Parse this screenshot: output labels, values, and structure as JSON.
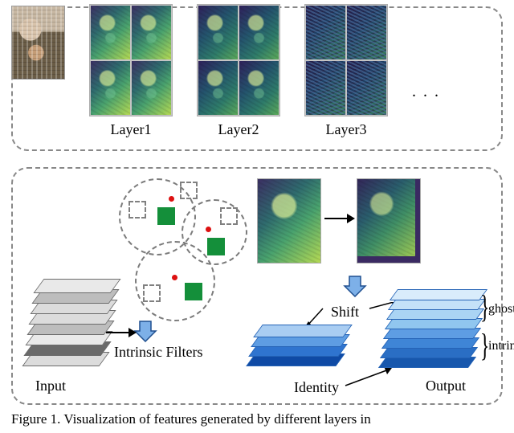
{
  "top": {
    "layers_shown": 3,
    "layer_labels": [
      "Layer1",
      "Layer2",
      "Layer3"
    ],
    "ellipsis": ". . ."
  },
  "bottom": {
    "input_label": "Input",
    "filters_label": "Intrinsic Filters",
    "shift_label": "Shift",
    "identity_label": "Identity",
    "output_label": "Output",
    "ghost_brace_label": "ghost",
    "intrinsic_brace_label": "intrinsic",
    "input_stack_layers": 8,
    "intrinsic_stack_layers": 4,
    "output_stack": {
      "ghost_layers": 4,
      "intrinsic_layers": 4
    }
  },
  "caption": "Figure 1. Visualization of features generated by different layers in",
  "colors": {
    "green": "#148f3a",
    "arrow_fill": "#7db0e8",
    "arrow_stroke": "#1f4f8f",
    "intrinsic_shades": [
      "#0f4aa5",
      "#2f74cf",
      "#5e9de3",
      "#a9cdf2"
    ],
    "output_shades": [
      "#d9ecfb",
      "#c4e1f8",
      "#aad4f4",
      "#90c6ef",
      "#5e9de3",
      "#3f85d6",
      "#2a6ec4",
      "#1757ad"
    ]
  }
}
